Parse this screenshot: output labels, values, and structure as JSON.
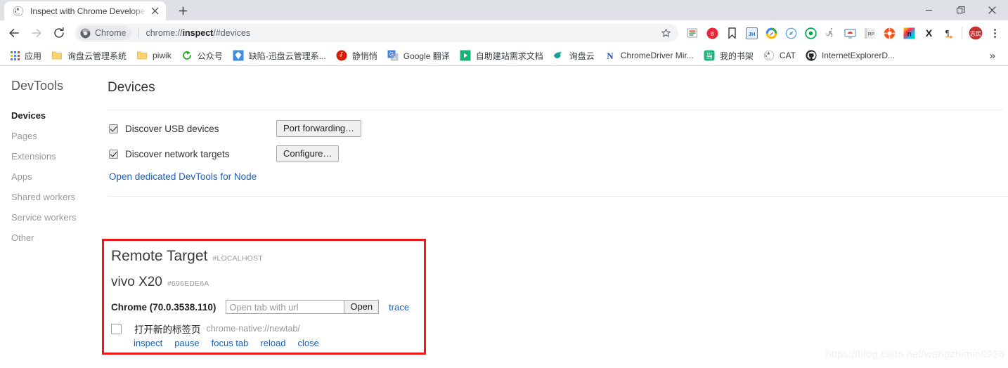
{
  "window": {
    "minimize_label": "Minimize",
    "maximize_label": "Restore",
    "close_label": "Close"
  },
  "tabstrip": {
    "tabs": [
      {
        "title": "Inspect with Chrome Develope",
        "favicon": "globe-icon",
        "close_label": "×"
      }
    ],
    "new_tab_label": "+"
  },
  "toolbar": {
    "back_label": "←",
    "forward_label": "→",
    "reload_label": "↻",
    "chip_label": "Chrome",
    "url_prefix": "chrome://",
    "url_bold": "inspect",
    "url_suffix": "/#devices",
    "url_full": "chrome://inspect/#devices",
    "star_label": "☆",
    "menu_label": "Customize and control Google Chrome",
    "extensions": [
      {
        "name": "notes-extension-icon"
      },
      {
        "name": "b-badge-extension-icon"
      },
      {
        "name": "bookmark-extension-icon"
      },
      {
        "name": "jh-extension-icon"
      },
      {
        "name": "pencil-circle-extension-icon"
      },
      {
        "name": "compass-extension-icon"
      },
      {
        "name": "green-ring-extension-icon"
      },
      {
        "name": "runner-extension-icon"
      },
      {
        "name": "screen-cast-extension-icon"
      },
      {
        "name": "rp-extension-icon"
      },
      {
        "name": "lifebuoy-extension-icon"
      },
      {
        "name": "rainbow-n-extension-icon"
      },
      {
        "name": "x-extension-icon"
      },
      {
        "name": "pilcrow-arrow-extension-icon"
      }
    ],
    "profile_label": "志民"
  },
  "bookmarks": {
    "apps_label": "应用",
    "items": [
      {
        "label": "询盘云管理系统",
        "icon": "folder-icon"
      },
      {
        "label": "piwik",
        "icon": "folder-icon"
      },
      {
        "label": "公众号",
        "icon": "green-refresh-icon"
      },
      {
        "label": "缺陷-迅盘云管理系...",
        "icon": "blue-kite-icon"
      },
      {
        "label": "静悄悄",
        "icon": "netease-music-icon"
      },
      {
        "label": "Google 翻译",
        "icon": "google-translate-icon"
      },
      {
        "label": "自助建站需求文档",
        "icon": "green-play-icon"
      },
      {
        "label": "询盘云",
        "icon": "teal-bird-icon"
      },
      {
        "label": "ChromeDriver Mir...",
        "icon": "blue-n-icon"
      },
      {
        "label": "我的书架",
        "icon": "green-dang-icon"
      },
      {
        "label": "CAT",
        "icon": "globe-icon"
      },
      {
        "label": "InternetExplorerD...",
        "icon": "github-icon"
      }
    ],
    "overflow_label": "»"
  },
  "devtools": {
    "sidebar_title": "DevTools",
    "sidebar_items": [
      {
        "label": "Devices",
        "active": true
      },
      {
        "label": "Pages",
        "active": false
      },
      {
        "label": "Extensions",
        "active": false
      },
      {
        "label": "Apps",
        "active": false
      },
      {
        "label": "Shared workers",
        "active": false
      },
      {
        "label": "Service workers",
        "active": false
      },
      {
        "label": "Other",
        "active": false
      }
    ],
    "page_title": "Devices",
    "discover_usb": {
      "label": "Discover USB devices",
      "checked": true,
      "button": "Port forwarding…"
    },
    "discover_network": {
      "label": "Discover network targets",
      "checked": true,
      "button": "Configure…"
    },
    "node_link": "Open dedicated DevTools for Node",
    "remote_target": {
      "title": "Remote Target",
      "id": "#LOCALHOST",
      "device_name": "vivo X20",
      "device_id": "#696EDE6A",
      "browser": "Chrome (70.0.3538.110)",
      "url_input_value": "",
      "url_input_placeholder": "Open tab with url",
      "open_button": "Open",
      "trace_link": "trace",
      "tab": {
        "checked": false,
        "name": "打开新的标签页",
        "url": "chrome-native://newtab/",
        "actions": [
          "inspect",
          "pause",
          "focus tab",
          "reload",
          "close"
        ]
      }
    },
    "highlight_color": "#f21616"
  },
  "watermark": "https://blog.csdn.net/wangzhimin0928"
}
